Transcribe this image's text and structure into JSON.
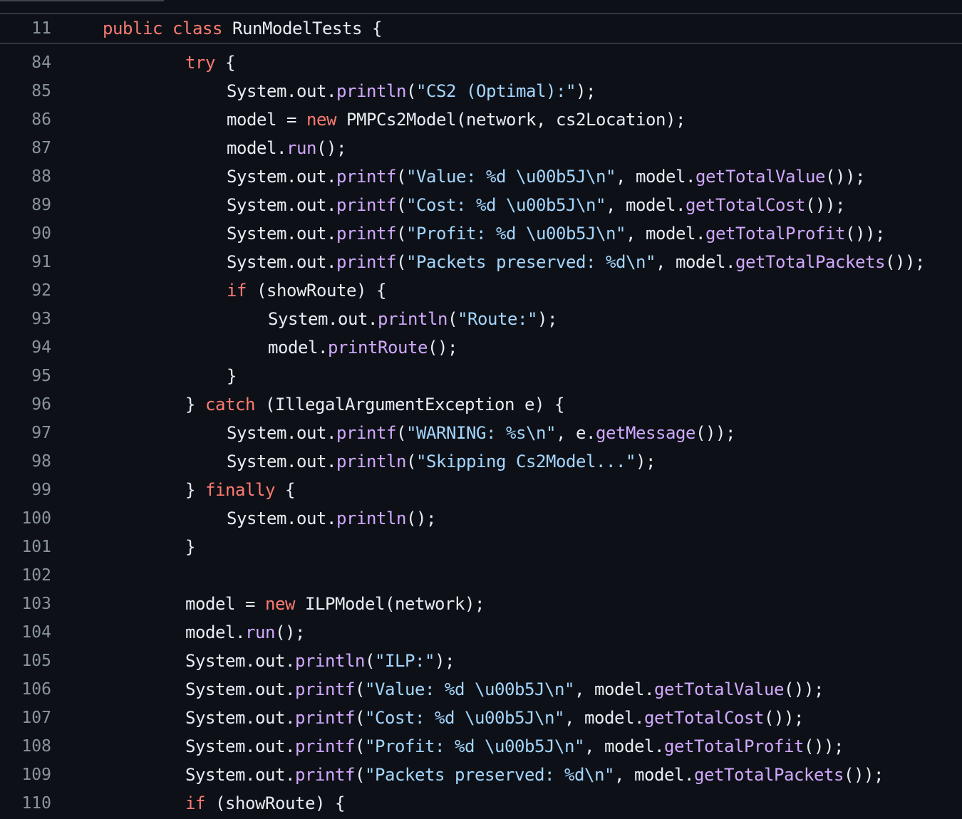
{
  "editor": {
    "sticky_line": {
      "num": "11",
      "tokens": [
        {
          "t": "public",
          "c": "kw"
        },
        {
          "t": " ",
          "c": "pl"
        },
        {
          "t": "class",
          "c": "kw"
        },
        {
          "t": " RunModelTests {",
          "c": "pl"
        }
      ]
    },
    "lines": [
      {
        "num": "84",
        "indent": 2,
        "tokens": [
          {
            "t": "try",
            "c": "kw"
          },
          {
            "t": " {",
            "c": "pl"
          }
        ]
      },
      {
        "num": "85",
        "indent": 3,
        "tokens": [
          {
            "t": "System.out.",
            "c": "pl"
          },
          {
            "t": "println",
            "c": "fn"
          },
          {
            "t": "(",
            "c": "pl"
          },
          {
            "t": "\"CS2 (Optimal):\"",
            "c": "str"
          },
          {
            "t": ");",
            "c": "pl"
          }
        ]
      },
      {
        "num": "86",
        "indent": 3,
        "tokens": [
          {
            "t": "model = ",
            "c": "pl"
          },
          {
            "t": "new",
            "c": "kw"
          },
          {
            "t": " PMPCs2Model(network, cs2Location);",
            "c": "pl"
          }
        ]
      },
      {
        "num": "87",
        "indent": 3,
        "tokens": [
          {
            "t": "model.",
            "c": "pl"
          },
          {
            "t": "run",
            "c": "fn"
          },
          {
            "t": "();",
            "c": "pl"
          }
        ]
      },
      {
        "num": "88",
        "indent": 3,
        "tokens": [
          {
            "t": "System.out.",
            "c": "pl"
          },
          {
            "t": "printf",
            "c": "fn"
          },
          {
            "t": "(",
            "c": "pl"
          },
          {
            "t": "\"Value: %d \\u00b5J\\n\"",
            "c": "str"
          },
          {
            "t": ", model.",
            "c": "pl"
          },
          {
            "t": "getTotalValue",
            "c": "fn"
          },
          {
            "t": "());",
            "c": "pl"
          }
        ]
      },
      {
        "num": "89",
        "indent": 3,
        "tokens": [
          {
            "t": "System.out.",
            "c": "pl"
          },
          {
            "t": "printf",
            "c": "fn"
          },
          {
            "t": "(",
            "c": "pl"
          },
          {
            "t": "\"Cost: %d \\u00b5J\\n\"",
            "c": "str"
          },
          {
            "t": ", model.",
            "c": "pl"
          },
          {
            "t": "getTotalCost",
            "c": "fn"
          },
          {
            "t": "());",
            "c": "pl"
          }
        ]
      },
      {
        "num": "90",
        "indent": 3,
        "tokens": [
          {
            "t": "System.out.",
            "c": "pl"
          },
          {
            "t": "printf",
            "c": "fn"
          },
          {
            "t": "(",
            "c": "pl"
          },
          {
            "t": "\"Profit: %d \\u00b5J\\n\"",
            "c": "str"
          },
          {
            "t": ", model.",
            "c": "pl"
          },
          {
            "t": "getTotalProfit",
            "c": "fn"
          },
          {
            "t": "());",
            "c": "pl"
          }
        ]
      },
      {
        "num": "91",
        "indent": 3,
        "tokens": [
          {
            "t": "System.out.",
            "c": "pl"
          },
          {
            "t": "printf",
            "c": "fn"
          },
          {
            "t": "(",
            "c": "pl"
          },
          {
            "t": "\"Packets preserved: %d\\n\"",
            "c": "str"
          },
          {
            "t": ", model.",
            "c": "pl"
          },
          {
            "t": "getTotalPackets",
            "c": "fn"
          },
          {
            "t": "());",
            "c": "pl"
          }
        ]
      },
      {
        "num": "92",
        "indent": 3,
        "tokens": [
          {
            "t": "if",
            "c": "kw"
          },
          {
            "t": " (showRoute) {",
            "c": "pl"
          }
        ]
      },
      {
        "num": "93",
        "indent": 4,
        "tokens": [
          {
            "t": "System.out.",
            "c": "pl"
          },
          {
            "t": "println",
            "c": "fn"
          },
          {
            "t": "(",
            "c": "pl"
          },
          {
            "t": "\"Route:\"",
            "c": "str"
          },
          {
            "t": ");",
            "c": "pl"
          }
        ]
      },
      {
        "num": "94",
        "indent": 4,
        "tokens": [
          {
            "t": "model.",
            "c": "pl"
          },
          {
            "t": "printRoute",
            "c": "fn"
          },
          {
            "t": "();",
            "c": "pl"
          }
        ]
      },
      {
        "num": "95",
        "indent": 3,
        "tokens": [
          {
            "t": "}",
            "c": "pl"
          }
        ]
      },
      {
        "num": "96",
        "indent": 2,
        "tokens": [
          {
            "t": "} ",
            "c": "pl"
          },
          {
            "t": "catch",
            "c": "kw"
          },
          {
            "t": " (IllegalArgumentException e) {",
            "c": "pl"
          }
        ]
      },
      {
        "num": "97",
        "indent": 3,
        "tokens": [
          {
            "t": "System.out.",
            "c": "pl"
          },
          {
            "t": "printf",
            "c": "fn"
          },
          {
            "t": "(",
            "c": "pl"
          },
          {
            "t": "\"WARNING: %s\\n\"",
            "c": "str"
          },
          {
            "t": ", e.",
            "c": "pl"
          },
          {
            "t": "getMessage",
            "c": "fn"
          },
          {
            "t": "());",
            "c": "pl"
          }
        ]
      },
      {
        "num": "98",
        "indent": 3,
        "tokens": [
          {
            "t": "System.out.",
            "c": "pl"
          },
          {
            "t": "println",
            "c": "fn"
          },
          {
            "t": "(",
            "c": "pl"
          },
          {
            "t": "\"Skipping Cs2Model...\"",
            "c": "str"
          },
          {
            "t": ");",
            "c": "pl"
          }
        ]
      },
      {
        "num": "99",
        "indent": 2,
        "tokens": [
          {
            "t": "} ",
            "c": "pl"
          },
          {
            "t": "finally",
            "c": "kw"
          },
          {
            "t": " {",
            "c": "pl"
          }
        ]
      },
      {
        "num": "100",
        "indent": 3,
        "tokens": [
          {
            "t": "System.out.",
            "c": "pl"
          },
          {
            "t": "println",
            "c": "fn"
          },
          {
            "t": "();",
            "c": "pl"
          }
        ]
      },
      {
        "num": "101",
        "indent": 2,
        "tokens": [
          {
            "t": "}",
            "c": "pl"
          }
        ]
      },
      {
        "num": "102",
        "indent": 0,
        "tokens": []
      },
      {
        "num": "103",
        "indent": 2,
        "tokens": [
          {
            "t": "model = ",
            "c": "pl"
          },
          {
            "t": "new",
            "c": "kw"
          },
          {
            "t": " ILPModel(network);",
            "c": "pl"
          }
        ]
      },
      {
        "num": "104",
        "indent": 2,
        "tokens": [
          {
            "t": "model.",
            "c": "pl"
          },
          {
            "t": "run",
            "c": "fn"
          },
          {
            "t": "();",
            "c": "pl"
          }
        ]
      },
      {
        "num": "105",
        "indent": 2,
        "tokens": [
          {
            "t": "System.out.",
            "c": "pl"
          },
          {
            "t": "println",
            "c": "fn"
          },
          {
            "t": "(",
            "c": "pl"
          },
          {
            "t": "\"ILP:\"",
            "c": "str"
          },
          {
            "t": ");",
            "c": "pl"
          }
        ]
      },
      {
        "num": "106",
        "indent": 2,
        "tokens": [
          {
            "t": "System.out.",
            "c": "pl"
          },
          {
            "t": "printf",
            "c": "fn"
          },
          {
            "t": "(",
            "c": "pl"
          },
          {
            "t": "\"Value: %d \\u00b5J\\n\"",
            "c": "str"
          },
          {
            "t": ", model.",
            "c": "pl"
          },
          {
            "t": "getTotalValue",
            "c": "fn"
          },
          {
            "t": "());",
            "c": "pl"
          }
        ]
      },
      {
        "num": "107",
        "indent": 2,
        "tokens": [
          {
            "t": "System.out.",
            "c": "pl"
          },
          {
            "t": "printf",
            "c": "fn"
          },
          {
            "t": "(",
            "c": "pl"
          },
          {
            "t": "\"Cost: %d \\u00b5J\\n\"",
            "c": "str"
          },
          {
            "t": ", model.",
            "c": "pl"
          },
          {
            "t": "getTotalCost",
            "c": "fn"
          },
          {
            "t": "());",
            "c": "pl"
          }
        ]
      },
      {
        "num": "108",
        "indent": 2,
        "tokens": [
          {
            "t": "System.out.",
            "c": "pl"
          },
          {
            "t": "printf",
            "c": "fn"
          },
          {
            "t": "(",
            "c": "pl"
          },
          {
            "t": "\"Profit: %d \\u00b5J\\n\"",
            "c": "str"
          },
          {
            "t": ", model.",
            "c": "pl"
          },
          {
            "t": "getTotalProfit",
            "c": "fn"
          },
          {
            "t": "());",
            "c": "pl"
          }
        ]
      },
      {
        "num": "109",
        "indent": 2,
        "tokens": [
          {
            "t": "System.out.",
            "c": "pl"
          },
          {
            "t": "printf",
            "c": "fn"
          },
          {
            "t": "(",
            "c": "pl"
          },
          {
            "t": "\"Packets preserved: %d\\n\"",
            "c": "str"
          },
          {
            "t": ", model.",
            "c": "pl"
          },
          {
            "t": "getTotalPackets",
            "c": "fn"
          },
          {
            "t": "());",
            "c": "pl"
          }
        ]
      },
      {
        "num": "110",
        "indent": 2,
        "tokens": [
          {
            "t": "if",
            "c": "kw"
          },
          {
            "t": " (showRoute) {",
            "c": "pl"
          }
        ]
      }
    ]
  },
  "colors": {
    "background": "#0d1117",
    "line_number": "#8b949e",
    "keyword": "#ff7b72",
    "string": "#a5d6ff",
    "function": "#d2a8ff",
    "plain": "#e6edf3"
  }
}
